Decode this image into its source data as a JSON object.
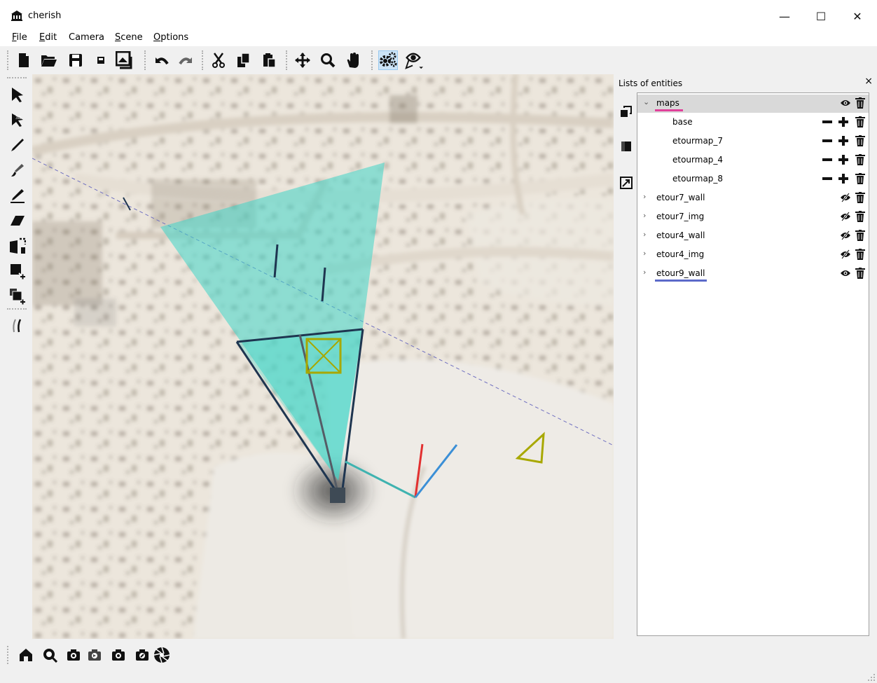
{
  "app": {
    "title": "cherish"
  },
  "window_controls": {
    "minimize": "—",
    "maximize": "☐",
    "close": "✕"
  },
  "menu": [
    {
      "label": "File",
      "underline": "F",
      "rest": "ile"
    },
    {
      "label": "Edit",
      "underline": "E",
      "rest": "dit"
    },
    {
      "label": "Camera",
      "underline": "",
      "rest": "Camera"
    },
    {
      "label": "Scene",
      "underline": "S",
      "rest": "cene"
    },
    {
      "label": "Options",
      "underline": "O",
      "rest": "ptions"
    }
  ],
  "toolbar": {
    "icons": [
      "new-file-icon",
      "open-folder-icon",
      "save-icon",
      "save-small-icon",
      "export-image-icon",
      "undo-icon",
      "redo-icon",
      "cut-icon",
      "copy-icon",
      "paste-icon",
      "move-icon",
      "zoom-icon",
      "pan-hand-icon",
      "settings-gears-icon",
      "viewing-eye-icon"
    ]
  },
  "left_tools": [
    "select-arrow-icon",
    "select-3d-icon",
    "pen-icon",
    "brush-icon",
    "pencil-icon",
    "eraser-icon",
    "canvas-select-icon",
    "add-canvas-icon",
    "copy-canvas-icon",
    "stroke-icon"
  ],
  "bottom_tools": [
    "home-icon",
    "camera-search-icon",
    "camera-icon",
    "camera-prev-icon",
    "camera-add-icon",
    "camera-next-icon",
    "aperture-icon"
  ],
  "panel": {
    "title": "Lists of entities",
    "close": "×",
    "side_tabs": [
      "tab-group-icon",
      "tab-canvas-icon",
      "tab-photo-icon"
    ],
    "rows": [
      {
        "label": "maps",
        "expanded": true,
        "level": 0,
        "selected": true,
        "underline_color": "#e0409a",
        "actions": "eye"
      },
      {
        "label": "base",
        "level": 1,
        "actions": "minus-plus"
      },
      {
        "label": "etourmap_7",
        "level": 1,
        "actions": "minus-plus"
      },
      {
        "label": "etourmap_4",
        "level": 1,
        "actions": "minus-plus"
      },
      {
        "label": "etourmap_8",
        "level": 1,
        "actions": "minus-plus"
      },
      {
        "label": "etour7_wall",
        "expanded": false,
        "level": 0,
        "actions": "eye-hidden"
      },
      {
        "label": "etour7_img",
        "expanded": false,
        "level": 0,
        "actions": "eye-hidden"
      },
      {
        "label": "etour4_wall",
        "expanded": false,
        "level": 0,
        "actions": "eye-hidden"
      },
      {
        "label": "etour4_img",
        "expanded": false,
        "level": 0,
        "actions": "eye-hidden"
      },
      {
        "label": "etour9_wall",
        "expanded": false,
        "level": 0,
        "underline_color": "#5b6ac9",
        "actions": "eye"
      }
    ]
  },
  "colors": {
    "frustum_fill": "#3fd6c8",
    "frustum_edge": "#1e3550",
    "olive": "#a8a800",
    "axis_red": "#e23030",
    "axis_blue": "#3b8fd6",
    "axis_teal": "#3fb3b0",
    "dash_line": "#7070c0"
  }
}
